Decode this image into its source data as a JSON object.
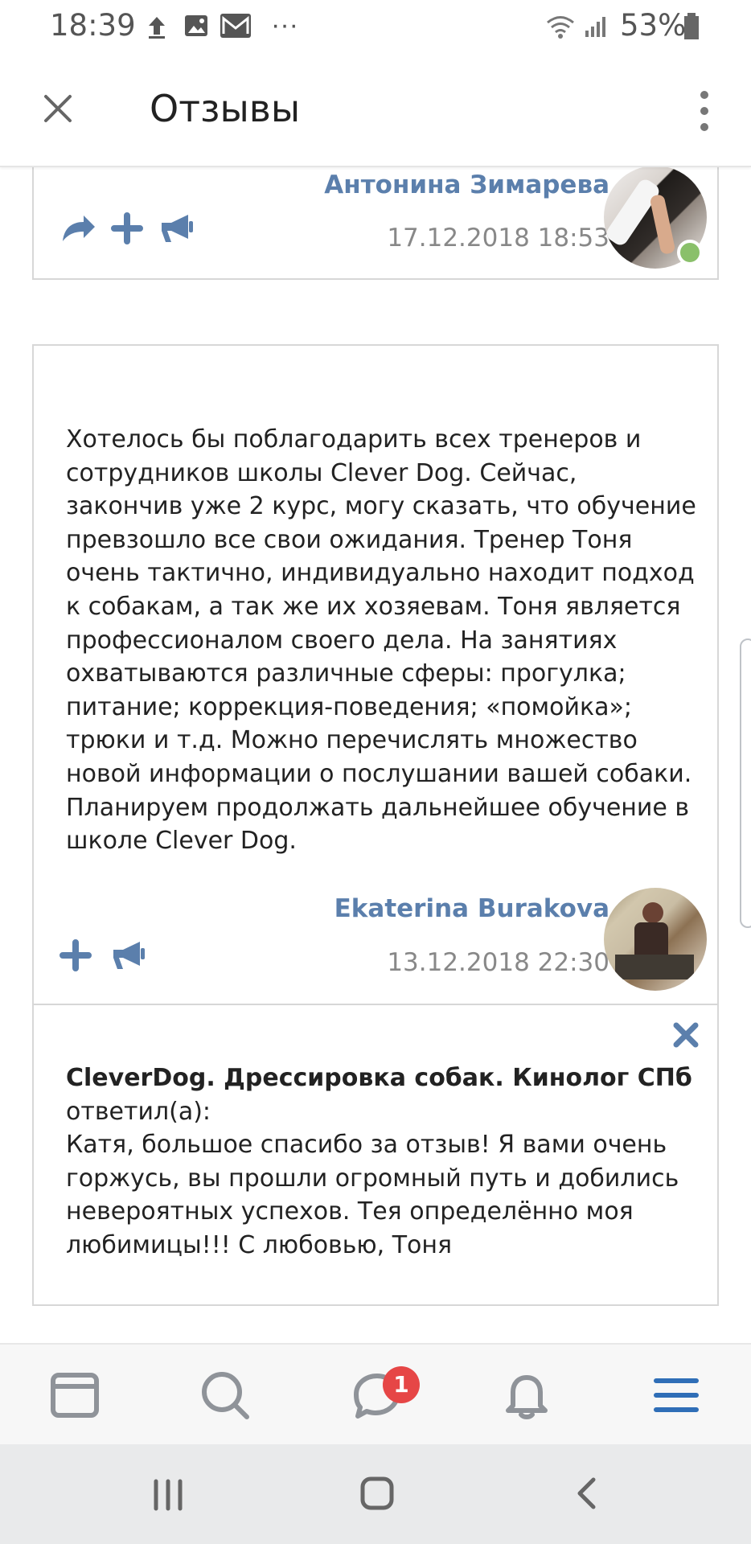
{
  "status_bar": {
    "time": "18:39",
    "notification_icons": [
      "upload-icon",
      "image-icon",
      "gmail-icon",
      "more-notifications-icon"
    ],
    "battery": "53%"
  },
  "header": {
    "title": "Отзывы",
    "close_icon": "close-icon",
    "menu_icon": "more-vertical-icon"
  },
  "reviews": [
    {
      "author": "Антонина Зимарева",
      "date": "17.12.2018 18:53",
      "actions": [
        "share-icon",
        "plus-icon",
        "megaphone-icon"
      ],
      "online": true
    },
    {
      "text": "Хотелось бы поблагодарить всех тренеров и сотрудников школы Clever Dog. Сейчас, закончив уже 2 курс, могу сказать, что обучение превзошло все свои ожидания. Тренер Тоня очень тактично, индивидуально находит подход к собакам, а так же их хозяевам. Тоня является профессионалом своего дела. На занятиях охватываются различные сферы: прогулка; питание; коррекция-поведения; «помойка»; трюки и т.д. Можно перечислять множество новой информации о послушании вашей собаки. Планируем продолжать дальнейшее обучение в школе Clever Dog.",
      "author": "Ekaterina Burakova",
      "date": "13.12.2018 22:30",
      "actions": [
        "plus-icon",
        "megaphone-icon"
      ]
    }
  ],
  "reply": {
    "author": "CleverDog. Дрессировка собак. Кинолог СПб",
    "verb": "ответил(а):",
    "text": "Катя, большое спасибо за отзыв! Я вами очень горжусь, вы прошли огромный путь и добились невероятных успехов. Тея определённо моя любимицы!!! С любовью, Тоня",
    "remove_icon": "close-icon"
  },
  "bottom_nav": {
    "items": [
      "news-icon",
      "search-icon",
      "messages-icon",
      "notifications-icon",
      "menu-icon"
    ],
    "messages_badge": "1",
    "active_item": "menu-icon",
    "active_color": "#2f6eb7"
  },
  "system_nav": {
    "items": [
      "recent-apps-icon",
      "home-icon",
      "back-icon"
    ]
  },
  "colors": {
    "accent": "#5b7fac",
    "online": "#8ac06a",
    "badge": "#e64646",
    "border": "#d7d7d7"
  }
}
